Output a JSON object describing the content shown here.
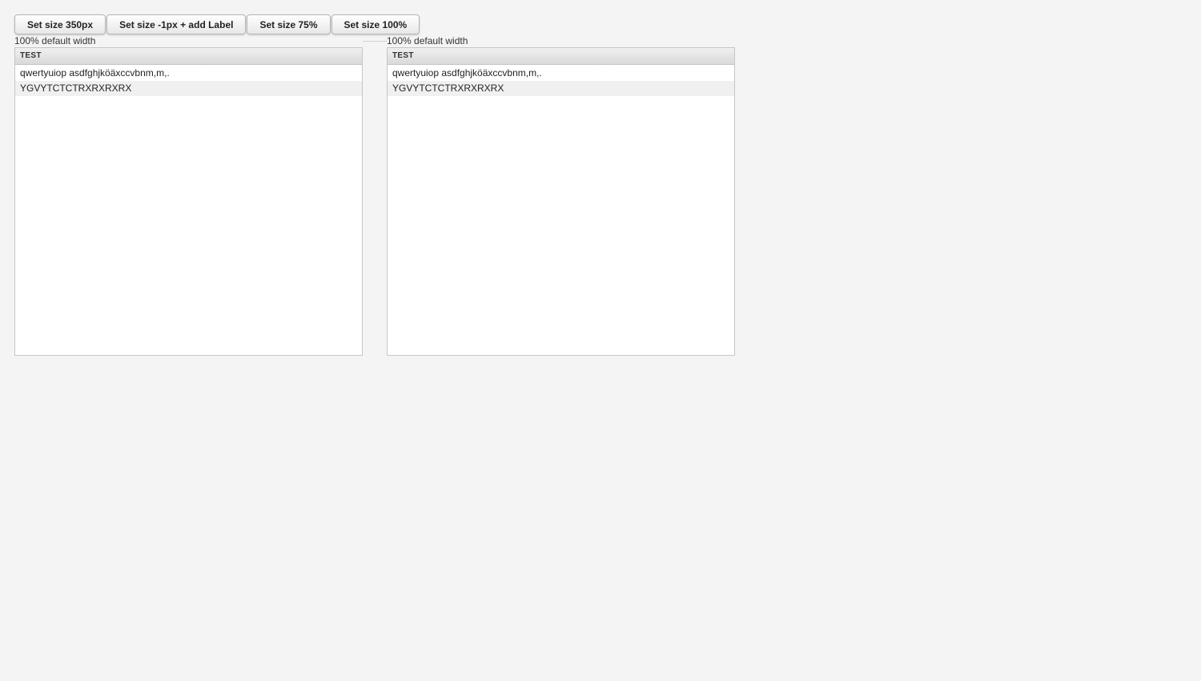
{
  "toolbar": {
    "buttons": [
      {
        "label": "Set size 350px"
      },
      {
        "label": "Set size -1px + add Label"
      },
      {
        "label": "Set size 75%"
      },
      {
        "label": "Set size 100%"
      }
    ]
  },
  "panels": [
    {
      "caption": "100% default width",
      "header": "TEST",
      "rows": [
        "qwertyuiop asdfghjköäxccvbnm,m,.",
        "YGVYTCTCTRXRXRXRX"
      ]
    },
    {
      "caption": "100% default width",
      "header": "TEST",
      "rows": [
        "qwertyuiop asdfghjköäxccvbnm,m,.",
        "YGVYTCTCTRXRXRXRX"
      ]
    }
  ]
}
